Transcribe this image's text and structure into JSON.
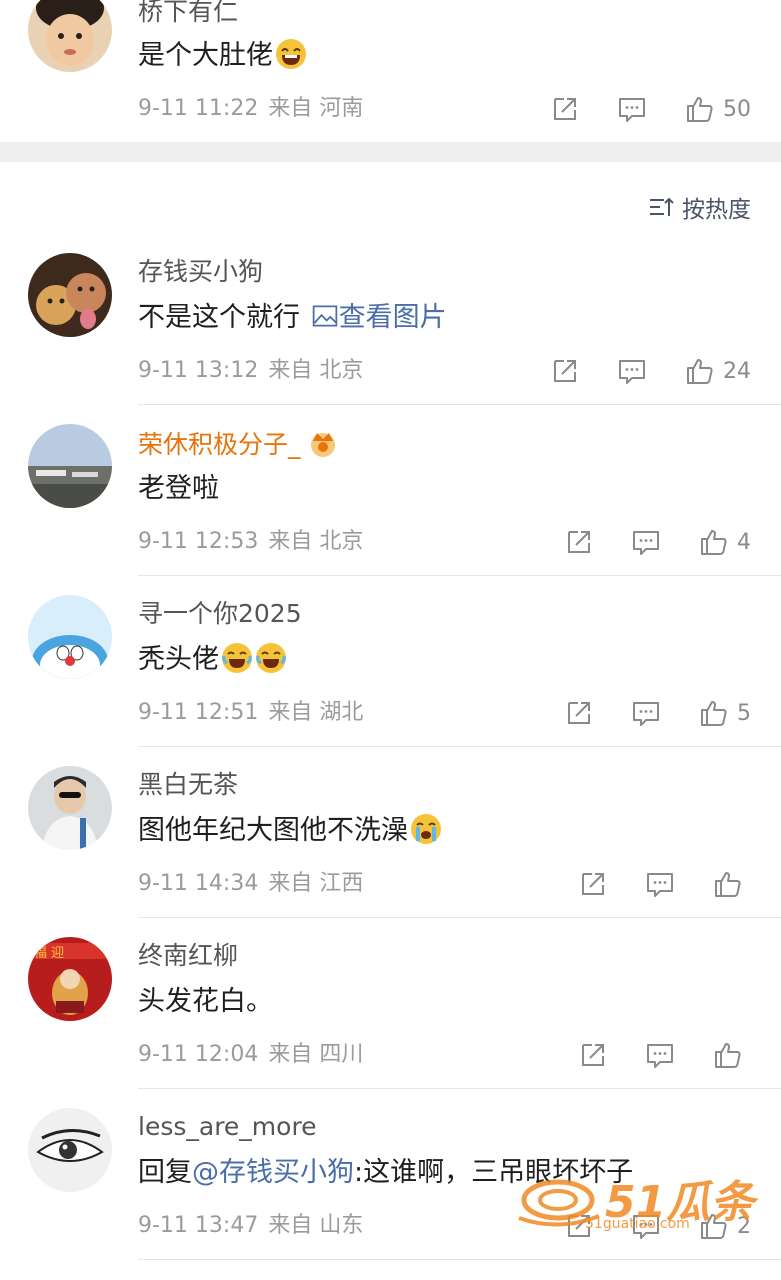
{
  "comments_top": [
    {
      "username": "桥下有仁",
      "text": "是个大肚佬",
      "time": "9-11 11:22",
      "source": "来自 河南",
      "likes": "50"
    }
  ],
  "sort": {
    "label": "按热度"
  },
  "comments": [
    {
      "username": "存钱买小狗",
      "text": "不是这个就行",
      "link_text": "查看图片",
      "time": "9-11 13:12",
      "source": "来自 北京",
      "likes": "24"
    },
    {
      "username": "荣休积极分子_",
      "text": "老登啦",
      "time": "9-11 12:53",
      "source": "来自 北京",
      "likes": "4"
    },
    {
      "username": "寻一个你2025",
      "text": "秃头佬",
      "time": "9-11 12:51",
      "source": "来自 湖北",
      "likes": "5"
    },
    {
      "username": "黑白无茶",
      "text": "图他年纪大图他不洗澡",
      "time": "9-11 14:34",
      "source": "来自 江西",
      "likes": ""
    },
    {
      "username": "终南红柳",
      "text": "头发花白。",
      "time": "9-11 12:04",
      "source": "来自 四川",
      "likes": ""
    },
    {
      "username": "less_are_more",
      "reply_prefix": "回复",
      "reply_mention": "@存钱买小狗",
      "text": ":这谁啊，三吊眼坏坏子",
      "time": "9-11 13:47",
      "source": "来自 山东",
      "likes": "2"
    }
  ],
  "watermark": {
    "brand": "51瓜条",
    "url": "51guatiao.com"
  },
  "colors": {
    "accent_gold": "#e8740c",
    "link": "#4a6ea9",
    "meta": "#9b9b9b"
  }
}
